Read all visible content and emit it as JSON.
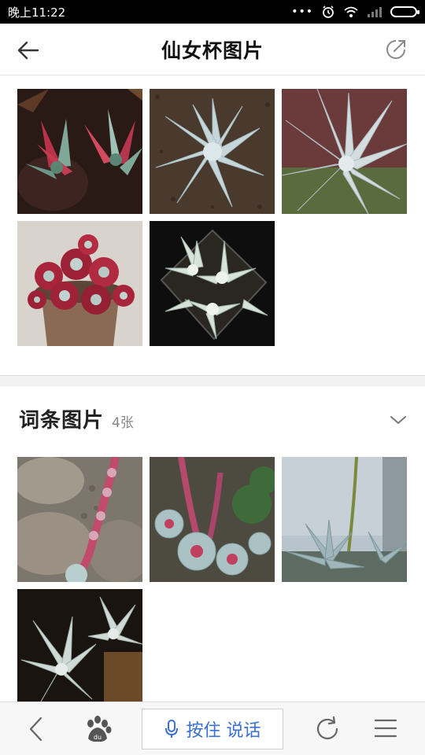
{
  "status_bar": {
    "time": "晚上11:22",
    "dots": "•••"
  },
  "header": {
    "title": "仙女杯图片"
  },
  "top_photos": [
    {
      "desc": "red-green succulent cluster"
    },
    {
      "desc": "pale blue rosette on soil"
    },
    {
      "desc": "silver spiky rosette"
    },
    {
      "desc": "red succulents in pot"
    },
    {
      "desc": "white rosettes in square pot"
    }
  ],
  "section": {
    "title": "词条图片",
    "count": "4张"
  },
  "bottom_bar": {
    "voice_label": "按住 说话"
  },
  "colors": {
    "accent": "#3a6fd4",
    "divider": "#f2f2f2"
  }
}
